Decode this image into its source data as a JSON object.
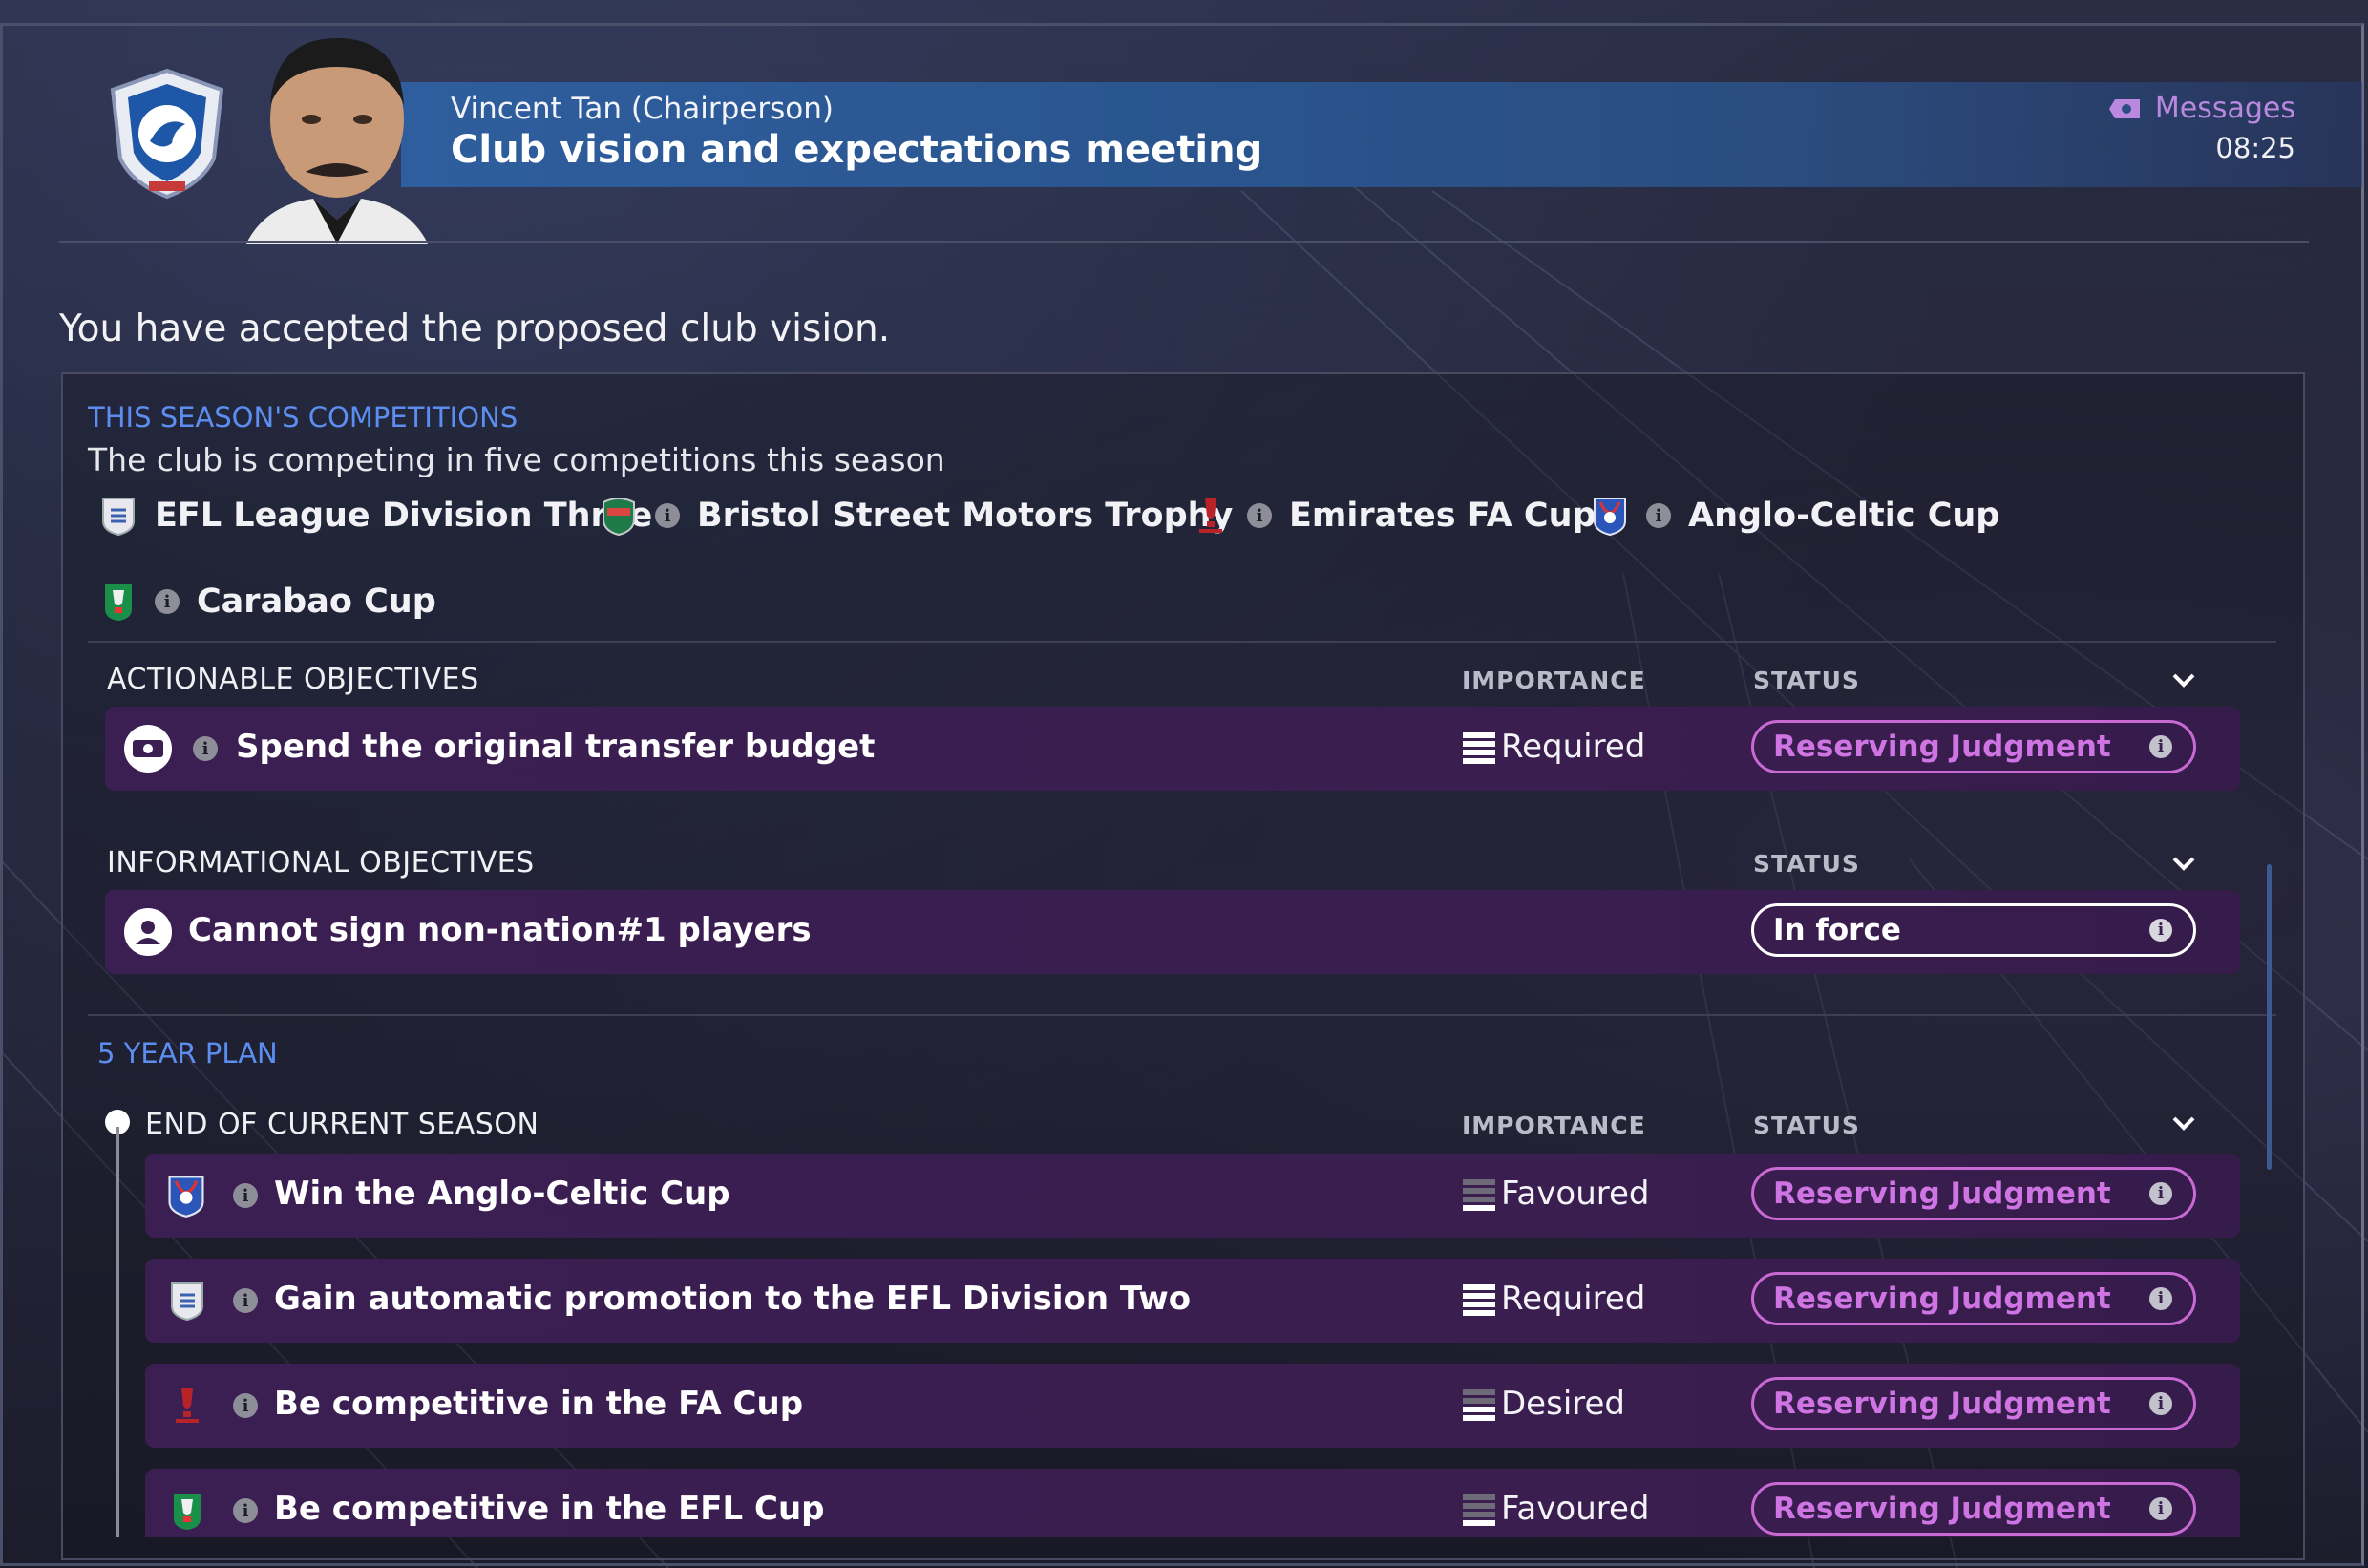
{
  "header": {
    "person": "Vincent Tan (Chairperson)",
    "title": "Club vision and expectations meeting",
    "messages_label": "Messages",
    "time": "08:25"
  },
  "accepted_message": "You have accepted the proposed club vision.",
  "competitions": {
    "section_title": "THIS SEASON'S COMPETITIONS",
    "subtitle": "The club is competing in five competitions this season",
    "items": [
      {
        "name": "EFL League Division Three",
        "icon": "efl-league-badge-icon"
      },
      {
        "name": "Bristol Street Motors Trophy",
        "icon": "trophy-badge-icon"
      },
      {
        "name": "Emirates FA Cup",
        "icon": "fa-cup-icon"
      },
      {
        "name": "Anglo-Celtic Cup",
        "icon": "anglo-celtic-cup-icon"
      },
      {
        "name": "Carabao Cup",
        "icon": "carabao-cup-icon"
      }
    ]
  },
  "actionable": {
    "header": "ACTIONABLE OBJECTIVES",
    "importance_label": "IMPORTANCE",
    "status_label": "STATUS",
    "rows": [
      {
        "text": "Spend the original transfer budget",
        "importance": "Required",
        "status": "Reserving Judgment",
        "icon": "money-icon"
      }
    ]
  },
  "informational": {
    "header": "INFORMATIONAL OBJECTIVES",
    "status_label": "STATUS",
    "rows": [
      {
        "text": "Cannot sign non-nation#1 players",
        "status": "In force",
        "icon": "person-icon"
      }
    ]
  },
  "plan": {
    "section_title": "5 YEAR PLAN",
    "header": "END OF CURRENT SEASON",
    "importance_label": "IMPORTANCE",
    "status_label": "STATUS",
    "rows": [
      {
        "text": "Win the Anglo-Celtic Cup",
        "importance": "Favoured",
        "status": "Reserving Judgment",
        "icon": "anglo-celtic-cup-icon"
      },
      {
        "text": "Gain automatic promotion to the EFL Division Two",
        "importance": "Required",
        "status": "Reserving Judgment",
        "icon": "efl-league-badge-icon"
      },
      {
        "text": "Be competitive in the FA Cup",
        "importance": "Desired",
        "status": "Reserving Judgment",
        "icon": "fa-cup-icon"
      },
      {
        "text": "Be competitive in the EFL Cup",
        "importance": "Favoured",
        "status": "Reserving Judgment",
        "icon": "carabao-cup-icon"
      }
    ]
  },
  "colors": {
    "accent_blue": "#5b8ef0",
    "status_purple": "#cf74e3",
    "row_bg": "#3b1f52",
    "messages": "#b989e0"
  }
}
